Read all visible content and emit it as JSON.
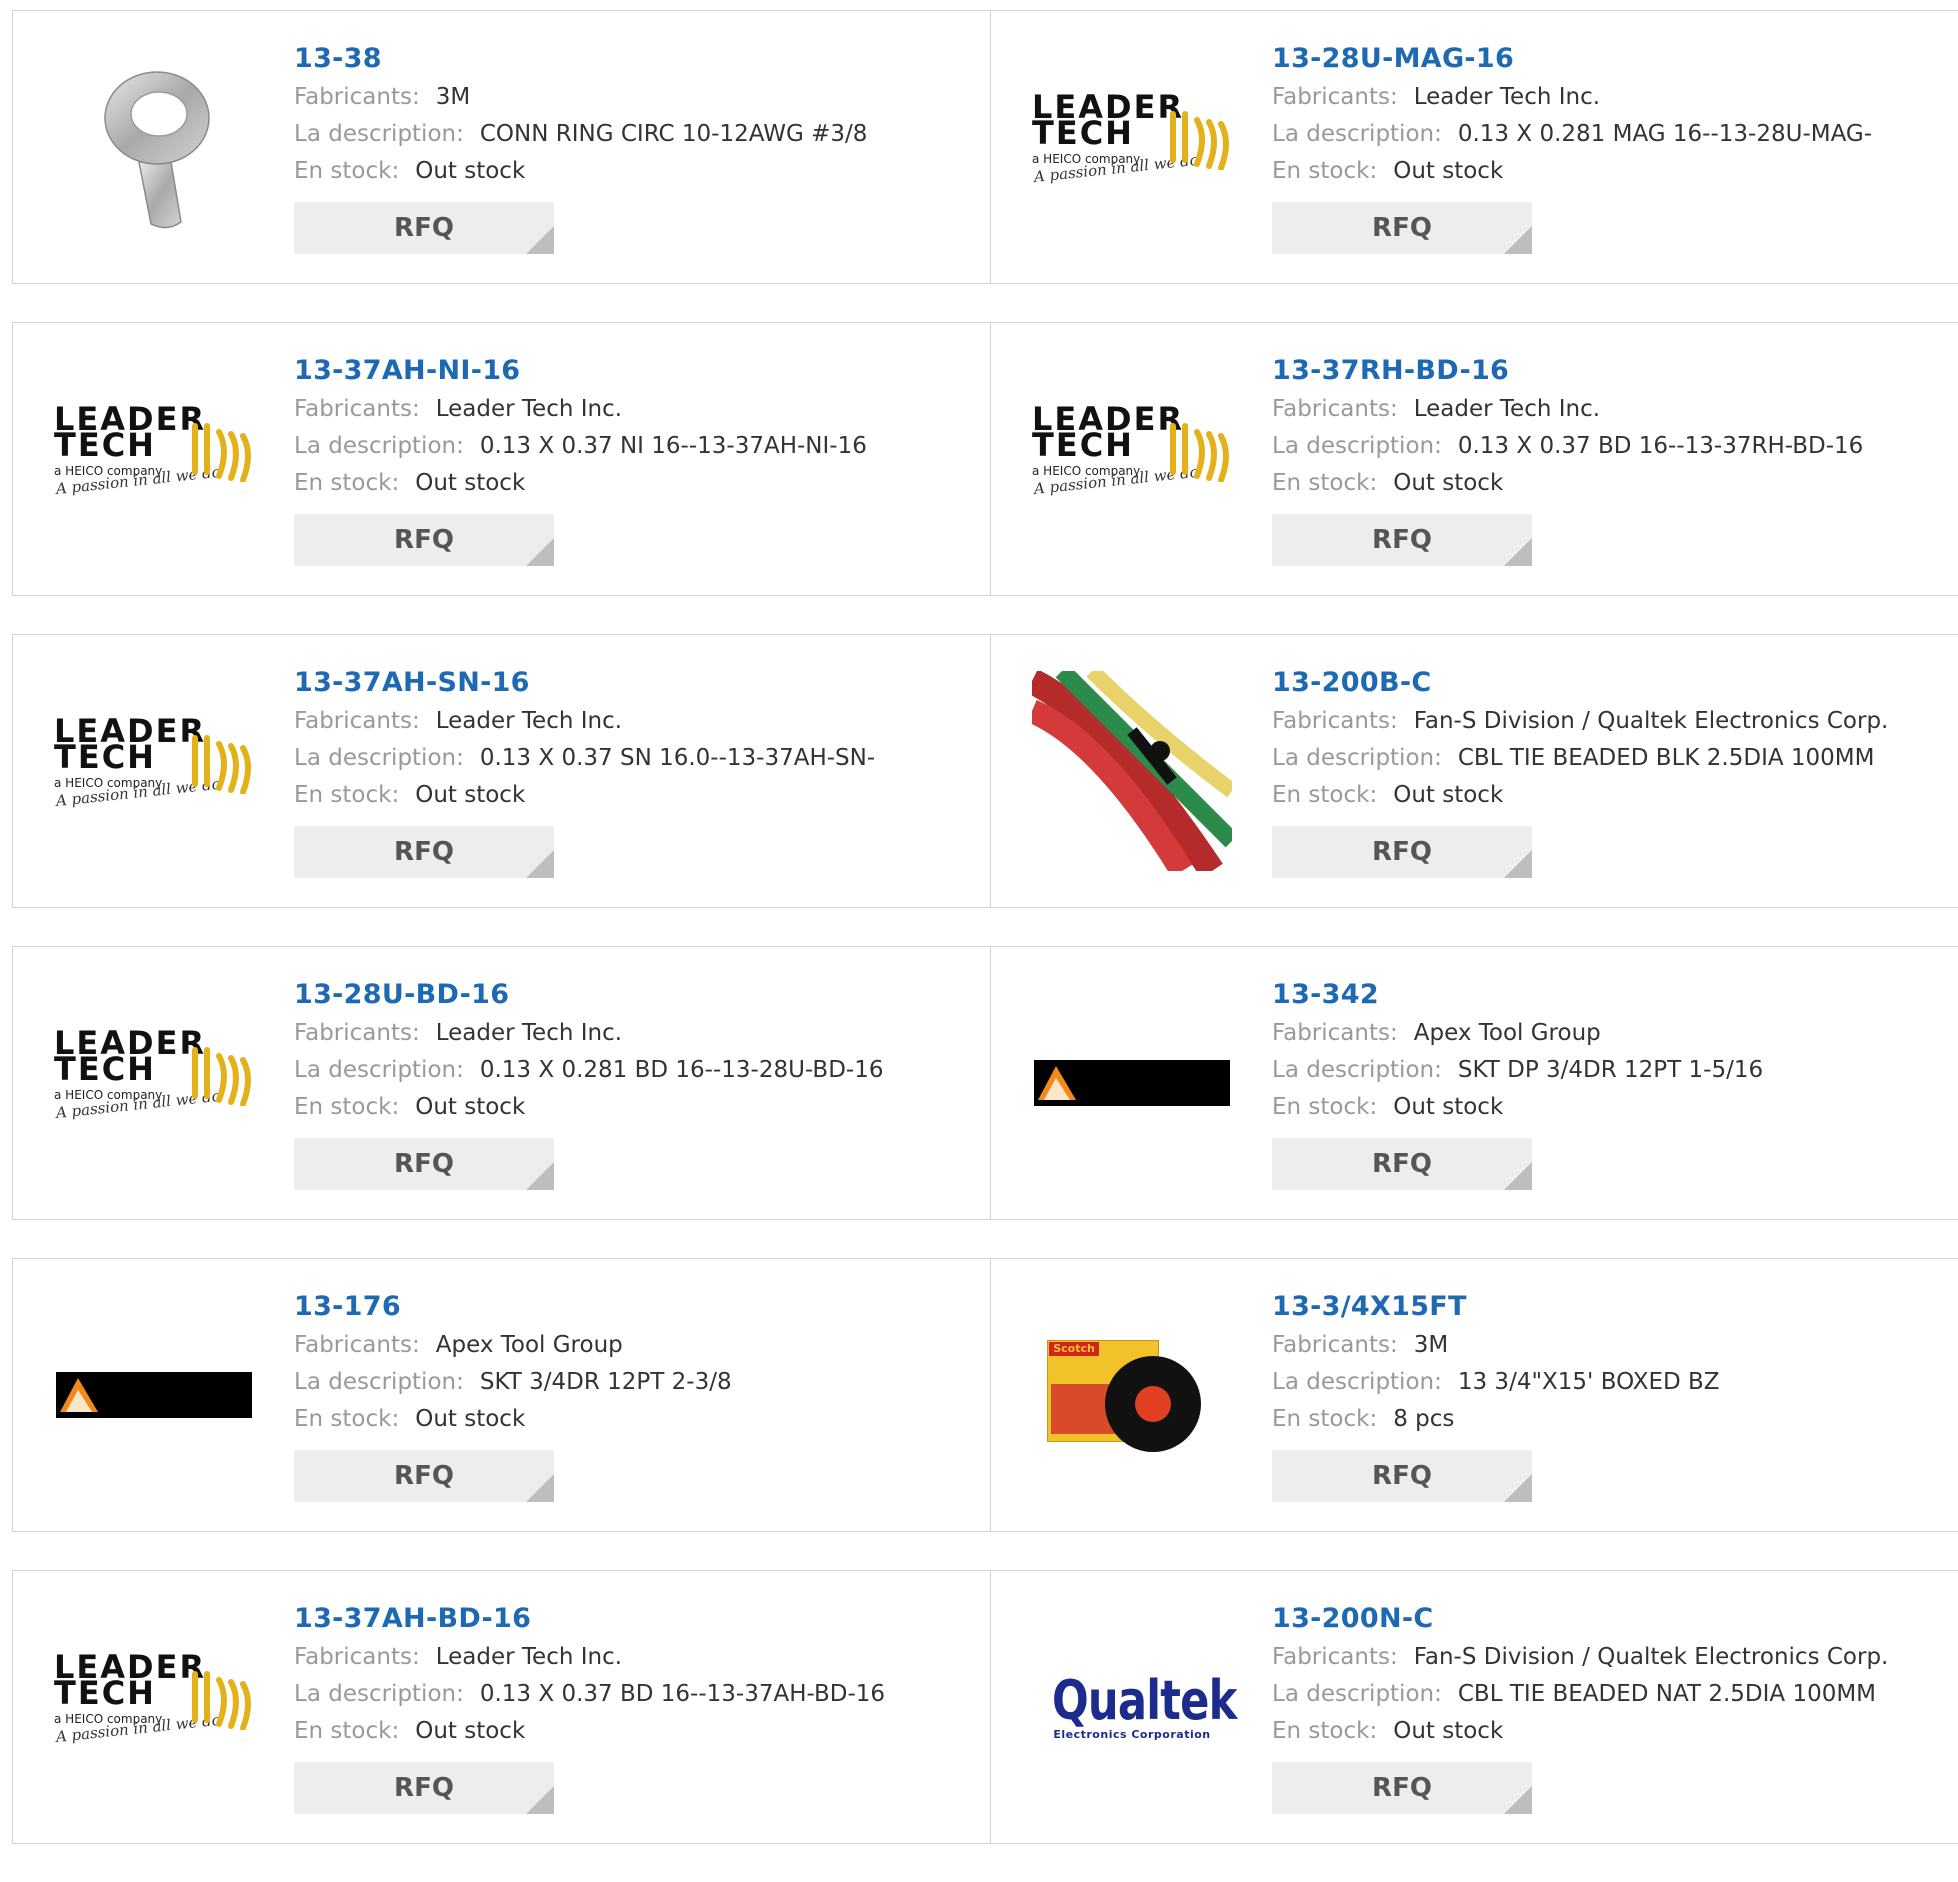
{
  "labels": {
    "manufacturer": "Fabricants:",
    "description": "La description:",
    "stock": "En stock:",
    "rfq": "RFQ"
  },
  "logos": {
    "leader": {
      "line1": "LEADER",
      "line2": "TECH",
      "line3": "a HEICO company",
      "tagline": "A passion in all we do"
    },
    "qualtek": {
      "name": "Qualtek",
      "sub": "Electronics Corporation"
    },
    "scotch": "Scotch"
  },
  "products": [
    {
      "part": "13-38",
      "manufacturer": "3M",
      "description": "CONN RING CIRC 10-12AWG #3/8",
      "stock": "Out stock",
      "image": "ring-terminal-icon"
    },
    {
      "part": "13-28U-MAG-16",
      "manufacturer": "Leader Tech Inc.",
      "description": "0.13 X 0.281 MAG 16--13-28U-MAG-",
      "stock": "Out stock",
      "image": "leader-tech-logo"
    },
    {
      "part": "13-37AH-NI-16",
      "manufacturer": "Leader Tech Inc.",
      "description": "0.13 X 0.37 NI 16--13-37AH-NI-16",
      "stock": "Out stock",
      "image": "leader-tech-logo"
    },
    {
      "part": "13-37RH-BD-16",
      "manufacturer": "Leader Tech Inc.",
      "description": "0.13 X 0.37 BD 16--13-37RH-BD-16",
      "stock": "Out stock",
      "image": "leader-tech-logo"
    },
    {
      "part": "13-37AH-SN-16",
      "manufacturer": "Leader Tech Inc.",
      "description": "0.13 X 0.37 SN 16.0--13-37AH-SN-",
      "stock": "Out stock",
      "image": "leader-tech-logo"
    },
    {
      "part": "13-200B-C",
      "manufacturer": "Fan-S Division / Qualtek Electronics Corp.",
      "description": "CBL TIE BEADED BLK 2.5DIA 100MM",
      "stock": "Out stock",
      "image": "cable-tie-photo"
    },
    {
      "part": "13-28U-BD-16",
      "manufacturer": "Leader Tech Inc.",
      "description": "0.13 X 0.281 BD 16--13-28U-BD-16",
      "stock": "Out stock",
      "image": "leader-tech-logo"
    },
    {
      "part": "13-342",
      "manufacturer": "Apex Tool Group",
      "description": "SKT DP 3/4DR 12PT 1-5/16",
      "stock": "Out stock",
      "image": "apex-logo"
    },
    {
      "part": "13-176",
      "manufacturer": "Apex Tool Group",
      "description": "SKT 3/4DR 12PT 2-3/8",
      "stock": "Out stock",
      "image": "apex-logo"
    },
    {
      "part": "13-3/4X15FT",
      "manufacturer": "3M",
      "description": "13 3/4\"X15' BOXED BZ",
      "stock": "8 pcs",
      "image": "scotch-tape-photo"
    },
    {
      "part": "13-37AH-BD-16",
      "manufacturer": "Leader Tech Inc.",
      "description": "0.13 X 0.37 BD 16--13-37AH-BD-16",
      "stock": "Out stock",
      "image": "leader-tech-logo"
    },
    {
      "part": "13-200N-C",
      "manufacturer": "Fan-S Division / Qualtek Electronics Corp.",
      "description": "CBL TIE BEADED NAT 2.5DIA 100MM",
      "stock": "Out stock",
      "image": "qualtek-logo"
    }
  ],
  "colors": {
    "link": "#1e69b3",
    "label": "#999999",
    "value": "#333333",
    "button_bg": "#ededed",
    "border": "#d3d3d3"
  }
}
